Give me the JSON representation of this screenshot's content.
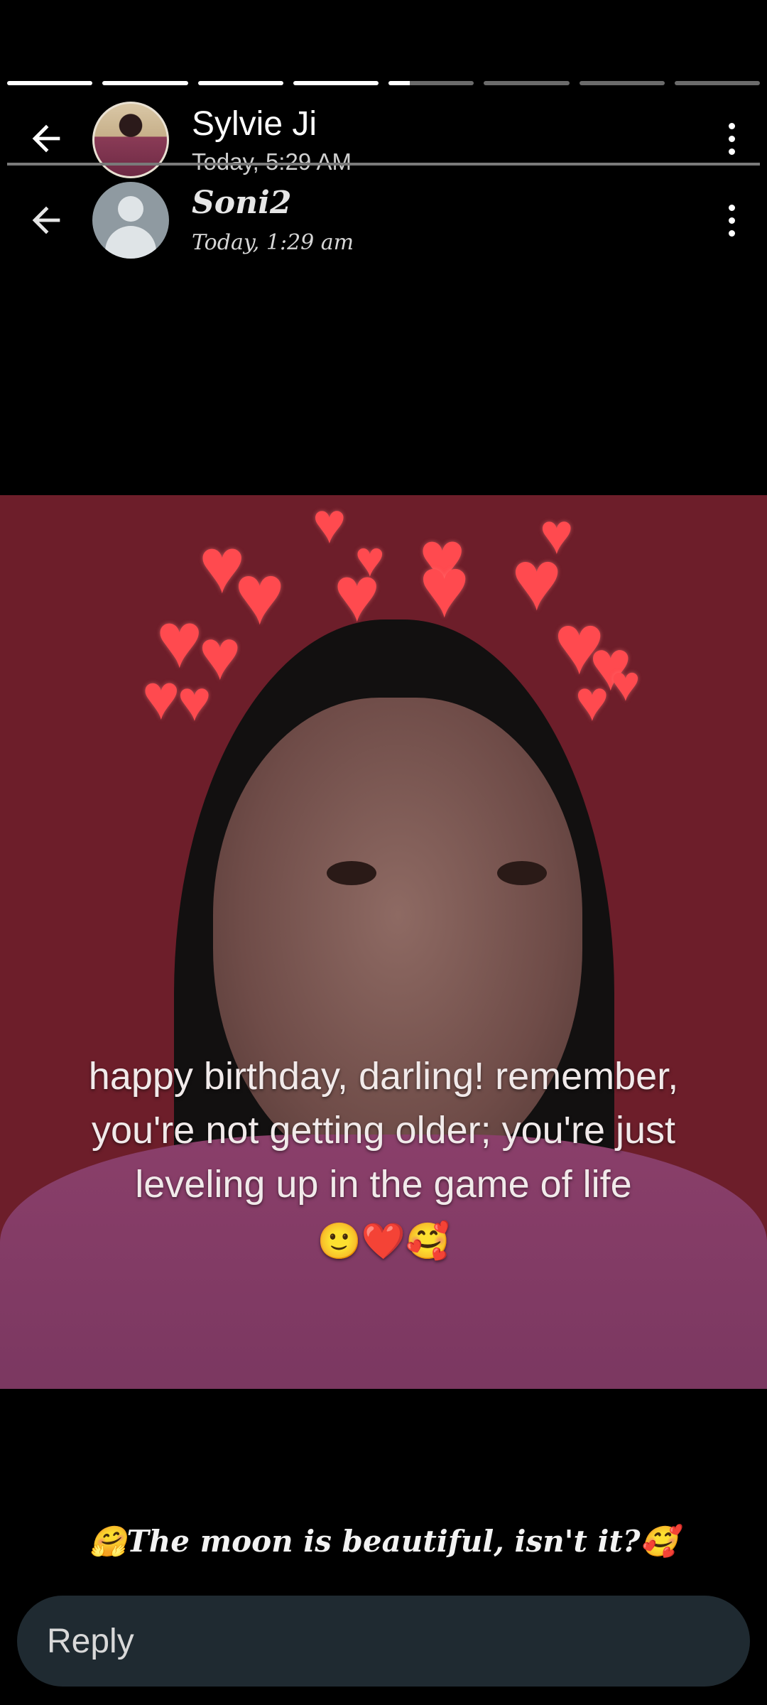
{
  "status": {
    "segments_total": 8,
    "segments_complete": 4,
    "current_segment_progress": 0.25
  },
  "header": {
    "name": "Sylvie Ji",
    "time": "Today, 5:29 AM"
  },
  "inner_header": {
    "name": "Soni2",
    "time": "Today, 1:29 am"
  },
  "photo": {
    "overlay_text": "happy birthday, darling! remember, you're not getting older; you're just leveling up in the game of life",
    "overlay_emojis": "🙂❤️🥰"
  },
  "caption": {
    "text": "🤗The moon is beautiful, isn't it?🥰"
  },
  "reply": {
    "placeholder": "Reply"
  },
  "colors": {
    "background": "#000000",
    "reply_bar": "#1f2a31",
    "photo_bg": "#6d1e2a",
    "heart": "#ff4a4f"
  },
  "icons": [
    "back-arrow-icon",
    "more-vertical-icon",
    "heart-icon",
    "person-placeholder-icon"
  ]
}
